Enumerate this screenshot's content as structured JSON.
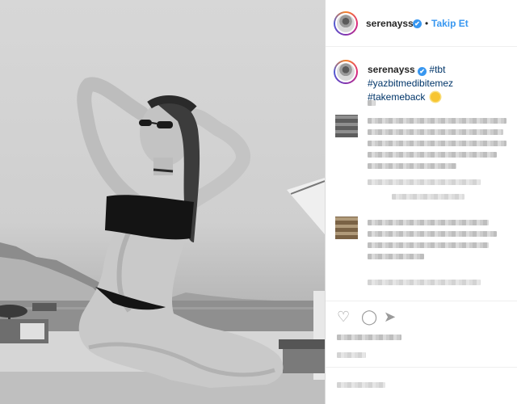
{
  "post": {
    "username": "serenayss",
    "verified_mark": "✔",
    "separator": "•",
    "follow_label": "Takip Et"
  },
  "caption": {
    "username": "serenayss",
    "tags": [
      "#tbt",
      "#yazbitmedibitemez",
      "#takemeback"
    ]
  },
  "icons": {
    "like": "heart-icon",
    "comment": "comment-icon",
    "share": "share-icon",
    "emoji": "sun-emoji-icon"
  },
  "colors": {
    "accent": "#3897f0",
    "text": "#262626",
    "hashtag": "#003569"
  }
}
